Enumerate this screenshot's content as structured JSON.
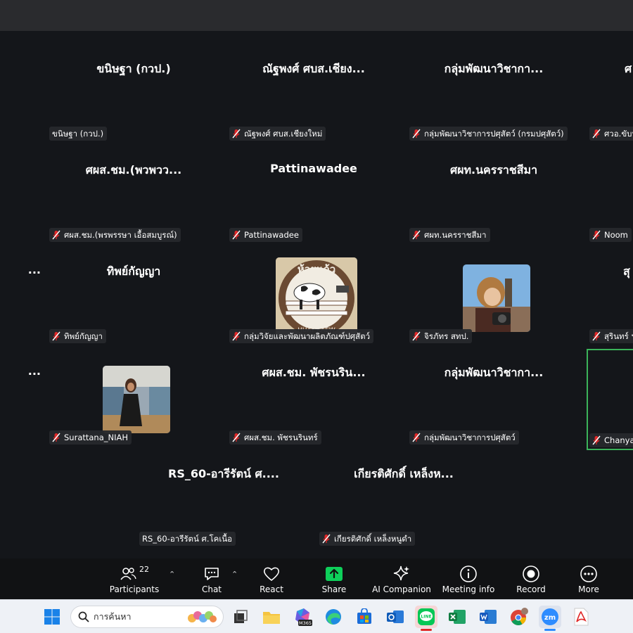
{
  "tiles": [
    {
      "big": "ขนิษฐา  (กวป.)",
      "tag": "ขนิษฐา  (กวป.)",
      "muted": false
    },
    {
      "big": "ณัฐพงศ์ ศบส.เชียง...",
      "tag": "ณัฐพงศ์ ศบส.เชียงใหม่",
      "muted": true
    },
    {
      "big": "กลุ่มพัฒนาวิชากา...",
      "tag": "กลุ่มพัฒนาวิชาการปศุสัตว์ (กรมปศุสัตว์)",
      "muted": true
    },
    {
      "big": "ศ",
      "tag": "ศวอ.ขับน",
      "muted": true
    },
    {
      "big": "ศผส.ชม.(พวพวว...",
      "tag": "ศผส.ชม.(พรพรรษา เอื้อสมบูรณ์)",
      "muted": true
    },
    {
      "big": "Pattinawadee",
      "tag": "Pattinawadee",
      "muted": true
    },
    {
      "big": "ศผท.นครราชสีมา",
      "tag": "ศผท.นครราชสีมา",
      "muted": true
    },
    {
      "big": "",
      "tag": "Noom",
      "muted": true
    },
    {
      "big": "...",
      "tag": "",
      "muted": false
    },
    {
      "big": "ทิพย์กัญญา",
      "tag": "ทิพย์กัญญา",
      "muted": true
    },
    {
      "big": "",
      "tag": "กลุ่มวิจัยและพัฒนาผลิตภัณฑ์ปศุสัตว์",
      "muted": true
    },
    {
      "big": "",
      "tag": "จิรภัทร สทป.",
      "muted": true
    },
    {
      "big": "สุ",
      "tag": "สุรินทร์ ฯ",
      "muted": true
    },
    {
      "big": "...",
      "tag": "",
      "muted": false
    },
    {
      "big": "",
      "tag": "Surattana_NIAH",
      "muted": true
    },
    {
      "big": "ศผส.ชม. พัชรนริน...",
      "tag": "ศผส.ชม. พัชรนรินทร์",
      "muted": true
    },
    {
      "big": "กลุ่มพัฒนาวิชากา...",
      "tag": "กลุ่มพัฒนาวิชาการปศุสัตว์",
      "muted": true
    },
    {
      "big": "",
      "tag": "Chanya",
      "muted": true
    },
    {
      "big": "RS_60-อารีรัตน์ ศ....",
      "tag": "RS_60-อารีรัตน์ ศ.โคเนื้อ",
      "muted": false
    },
    {
      "big": "เกียรติศักดิ์ เหล็งห...",
      "tag": "เกียรติศักดิ์ เหล็งหนูดำ",
      "muted": true
    }
  ],
  "logo_text": {
    "top": "ห้วยแก้ว",
    "bottom": "HUAY KAEW"
  },
  "toolbar": {
    "participants_label": "Participants",
    "participants_count": "22",
    "chat_label": "Chat",
    "react_label": "React",
    "share_label": "Share",
    "ai_label": "AI Companion",
    "info_label": "Meeting info",
    "record_label": "Record",
    "more_label": "More"
  },
  "taskbar": {
    "search_placeholder": "การค้นหา",
    "m365_label": "M365"
  },
  "colors": {
    "bg": "#14161a",
    "share_green": "#0ecf5a",
    "highlight": "#3bb35a",
    "mute_red": "#e02828"
  }
}
